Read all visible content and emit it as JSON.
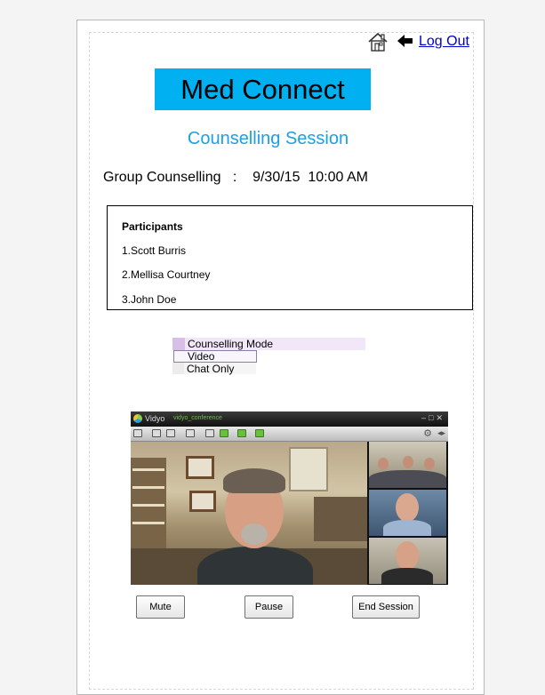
{
  "header": {
    "logout_label": "Log Out",
    "icons": [
      "home-icon",
      "back-arrow-icon"
    ]
  },
  "app": {
    "title": "Med Connect",
    "subtitle": "Counselling Session"
  },
  "session": {
    "line": "Group Counselling   :    9/30/15  10:00 AM"
  },
  "participants": {
    "heading": "Participants",
    "list": [
      "1.Scott Burris",
      "2.Mellisa Courtney",
      "3.John Doe"
    ]
  },
  "mode": {
    "header": "Counselling Mode",
    "options": [
      "Video",
      "Chat Only"
    ],
    "selected": "Video"
  },
  "video_window": {
    "app_name": "Vidyo",
    "status": "vidyo_conference"
  },
  "controls": {
    "mute_label": "Mute",
    "pause_label": "Pause",
    "end_label": "End Session"
  },
  "colors": {
    "title_bg": "#00b0f0",
    "subtitle": "#1ba1e2",
    "link": "#0000cc"
  }
}
